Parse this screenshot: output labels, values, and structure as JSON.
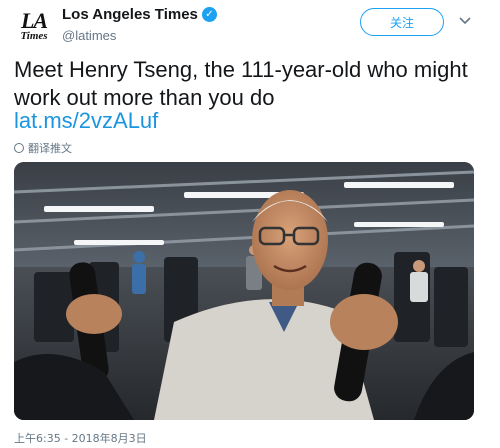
{
  "account": {
    "display_name": "Los Angeles Times",
    "handle": "@latimes",
    "avatar_line1": "LA",
    "avatar_line2": "Times",
    "verified_glyph": "✓"
  },
  "actions": {
    "follow_label": "关注",
    "menu_icon": "chevron-down-icon"
  },
  "tweet": {
    "text": "Meet Henry Tseng, the 111-year-old who might work out more than you do",
    "link": "lat.ms/2vzALuf",
    "translate_label": "翻译推文",
    "timestamp": "上午6:35 - 2018年8月3日"
  },
  "colors": {
    "accent": "#1da1f2",
    "link": "#1b95e0",
    "muted": "#657786",
    "text": "#14171a"
  }
}
